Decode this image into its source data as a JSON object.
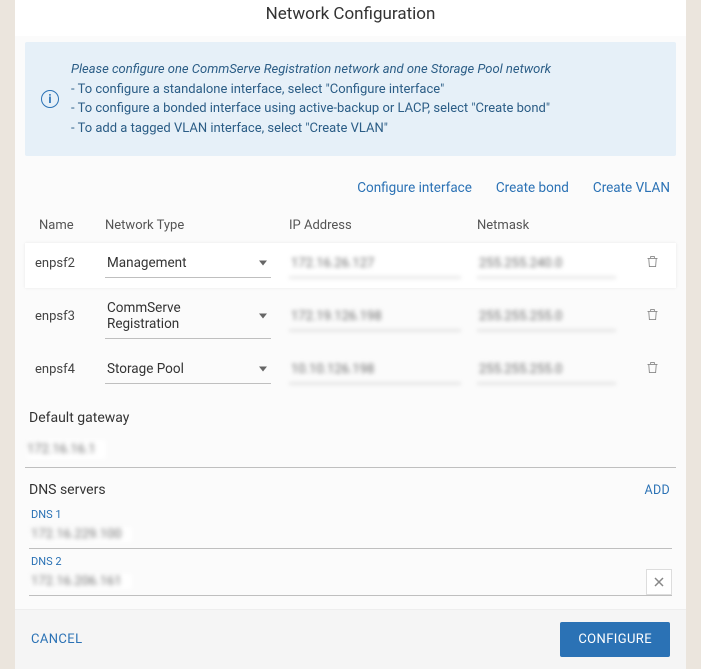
{
  "header": {
    "title": "Network Configuration"
  },
  "info": {
    "lead": "Please configure one CommServe Registration network and one Storage Pool network",
    "line1": "- To configure a standalone interface, select \"Configure interface\"",
    "line2": "- To configure a bonded interface using active-backup or LACP, select \"Create bond\"",
    "line3": "- To add a tagged VLAN interface, select \"Create VLAN\""
  },
  "actions": {
    "configure_interface": "Configure interface",
    "create_bond": "Create bond",
    "create_vlan": "Create VLAN"
  },
  "table": {
    "headers": {
      "name": "Name",
      "type": "Network Type",
      "ip": "IP Address",
      "mask": "Netmask"
    },
    "rows": [
      {
        "name": "enpsf2",
        "type": "Management",
        "ip": "172.16.26.127",
        "mask": "255.255.240.0"
      },
      {
        "name": "enpsf3",
        "type": "CommServe Registration",
        "ip": "172.19.126.198",
        "mask": "255.255.255.0"
      },
      {
        "name": "enpsf4",
        "type": "Storage Pool",
        "ip": "10.10.126.198",
        "mask": "255.255.255.0"
      }
    ]
  },
  "gateway": {
    "label": "Default gateway",
    "value": "172.16.16.1"
  },
  "dns": {
    "title": "DNS servers",
    "add": "ADD",
    "entries": [
      {
        "label": "DNS 1",
        "value": "172.16.229.100"
      },
      {
        "label": "DNS 2",
        "value": "172.16.206.161"
      }
    ]
  },
  "footer": {
    "cancel": "CANCEL",
    "configure": "CONFIGURE"
  }
}
